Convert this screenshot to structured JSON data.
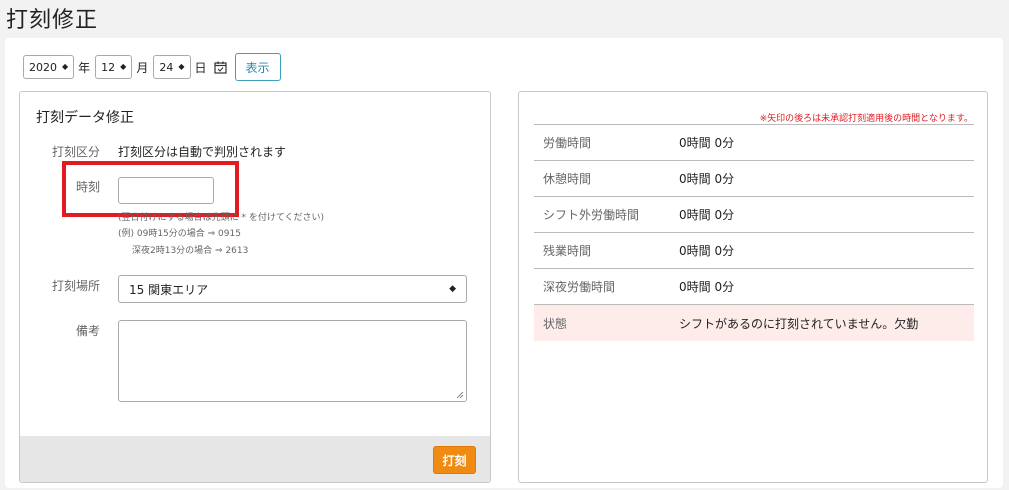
{
  "page": {
    "title": "打刻修正"
  },
  "date_bar": {
    "year": "2020",
    "year_unit": "年",
    "month": "12",
    "month_unit": "月",
    "day": "24",
    "day_unit": "日",
    "show_label": "表示"
  },
  "form": {
    "title": "打刻データ修正",
    "type_label": "打刻区分",
    "type_value": "打刻区分は自動で判別されます",
    "time_label": "時刻",
    "time_value": "",
    "help_line1": "(翌日付けにする場合は先頭に * を付けてください)",
    "help_line2": "(例) 09時15分の場合 ⇒ 0915",
    "help_line3": "深夜2時13分の場合 ⇒ 2613",
    "place_label": "打刻場所",
    "place_value": "15 関東エリア",
    "remarks_label": "備考",
    "remarks_value": "",
    "submit_label": "打刻"
  },
  "summary": {
    "note": "※矢印の後ろは未承認打刻適用後の時間となります。",
    "rows": [
      {
        "label": "労働時間",
        "value": "0時間 0分"
      },
      {
        "label": "休憩時間",
        "value": "0時間 0分"
      },
      {
        "label": "シフト外労働時間",
        "value": "0時間 0分"
      },
      {
        "label": "残業時間",
        "value": "0時間 0分"
      },
      {
        "label": "深夜労働時間",
        "value": "0時間 0分"
      }
    ],
    "status_label": "状態",
    "status_value": "シフトがあるのに打刻されていません。欠勤"
  },
  "colors": {
    "accent_orange": "#ef8a12",
    "highlight_red": "#e01b22",
    "status_bg": "#fdecea",
    "link_blue": "#2a89ad"
  }
}
